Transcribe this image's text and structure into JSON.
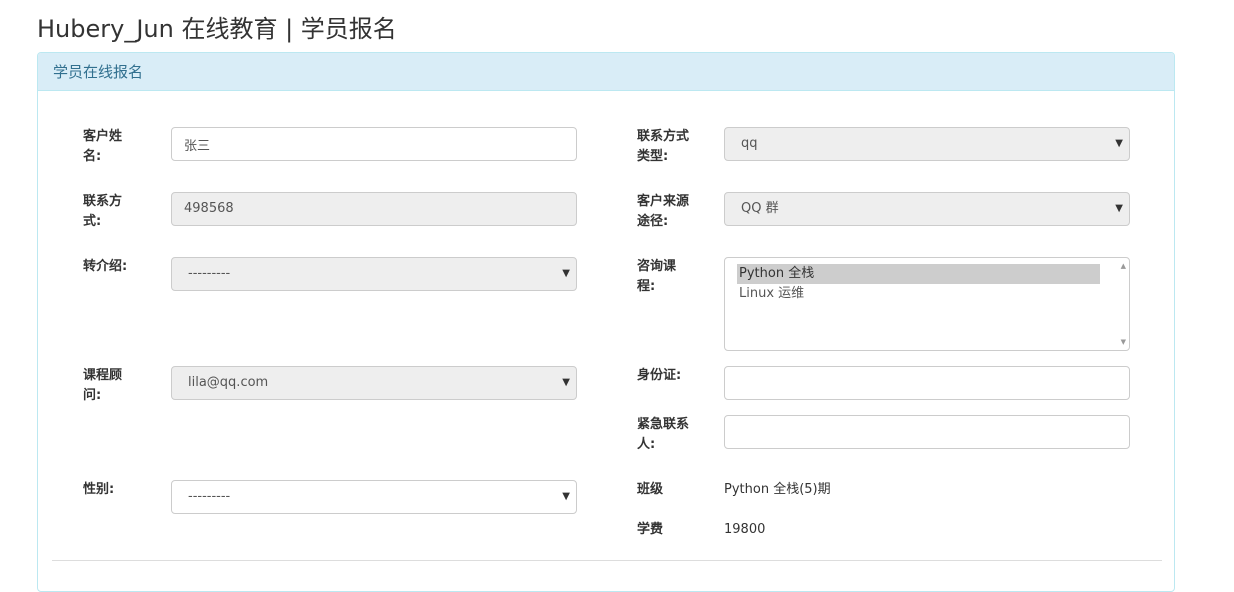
{
  "page": {
    "title": "Hubery_Jun 在线教育 | 学员报名"
  },
  "panel": {
    "heading": "学员在线报名"
  },
  "left": {
    "name": {
      "label": "客户姓名:",
      "value": "张三"
    },
    "contact": {
      "label": "联系方式:",
      "value": "498568"
    },
    "referral": {
      "label": "转介绍:",
      "value": "---------"
    },
    "consultant": {
      "label": "课程顾问:",
      "value": "lila@qq.com"
    },
    "gender": {
      "label": "性别:",
      "value": "---------"
    }
  },
  "right": {
    "contact_type": {
      "label": "联系方式类型:",
      "value": "qq"
    },
    "source": {
      "label": "客户来源途径:",
      "value": "QQ 群"
    },
    "course": {
      "label": "咨询课程:",
      "options": [
        "Python 全栈",
        "Linux 运维"
      ],
      "selected": "Python 全栈"
    },
    "id_card": {
      "label": "身份证:",
      "value": ""
    },
    "emergency": {
      "label": "紧急联系人:",
      "value": ""
    },
    "class": {
      "label": "班级",
      "value": "Python 全栈(5)期"
    },
    "tuition": {
      "label": "学费",
      "value": "19800"
    }
  },
  "colors": {
    "heading_bg": "#d9edf7",
    "heading_text": "#31708f",
    "border": "#bce8f1",
    "disabled_bg": "#eeeeee"
  },
  "icons": {
    "select_caret": "caret-down-icon"
  }
}
